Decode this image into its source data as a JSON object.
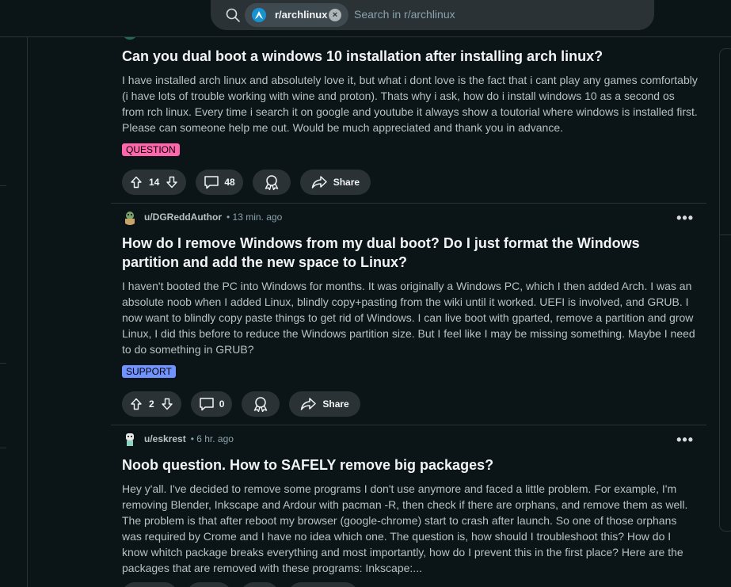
{
  "search": {
    "community": "r/archlinux",
    "placeholder": "Search in r/archlinux"
  },
  "posts": [
    {
      "title": "Can you dual boot a windows 10 installation after installing arch linux?",
      "body": "I have installed arch linux and absolutely love it, but what i dont love is the fact that i cant play any games comfortably (i have lots of trouble working with wine and proton). Thats why i ask, how do i install windows 10 as a second os from rch linux. Every time i search it on google and youtube it always show a toutorial where windows is installed first. Please can someone help me out. Would be much appreciated and thank you in advance.",
      "flair": "QUESTION",
      "flair_color": "#ff66ac",
      "votes": "14",
      "comments": "48",
      "share_label": "Share"
    },
    {
      "author": "u/DGReddAuthor",
      "time": "• 13 min. ago",
      "title": "How do I remove Windows from my dual boot? Do I just format the Windows partition and add the new space to Linux?",
      "body": "I haven't booted the PC into Windows for months. It was originally a Windows PC, which I then added Arch. I was an absolute noob when I added Linux, blindly copy+pasting from the wiki until it worked. UEFI is involved, and GRUB. I now want to blindly copy paste things to get rid of Windows. I can live boot with gparted, remove a partition and grow Linux, I did this before to reduce the Windows partition size. But I feel like I may be missing something. Maybe I need to do something in GRUB?",
      "flair": "SUPPORT",
      "flair_color": "#7193ff",
      "votes": "2",
      "comments": "0",
      "share_label": "Share"
    },
    {
      "author": "u/eskrest",
      "time": "• 6 hr. ago",
      "title": "Noob question. How to SAFELY remove big packages?",
      "body": "Hey y'all. I've decided to remove some programs I don't use anymore and faced a little problem. For example, I'm removing Blender, Inkscape and Ardour with pacman -R, then check if there are orphans, and remove them as well. The problem is that after reboot my browser (google-chrome) start to crash after launch. So one of those orphans was required by Crome and I have no idea which one. The question is, how should I troubleshoot this? How do I know whitch package breaks everything and most importantly, how do I prevent this in the first place? Here are the packages that are removed with these programs: Inkscape:..."
    }
  ],
  "more_label": "•••"
}
